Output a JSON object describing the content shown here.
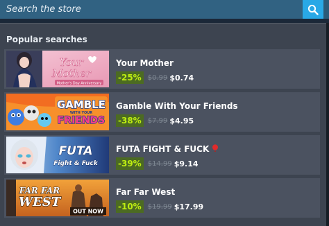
{
  "search": {
    "placeholder": "Search the store",
    "icon": "search-icon"
  },
  "popular": {
    "title": "Popular searches",
    "results": [
      {
        "title": "Your Mother",
        "discount": "-25%",
        "original_price": "$0.99",
        "final_price": "$0.74",
        "capsule": {
          "line1": "Your",
          "line2": "Mother",
          "subtitle": "Mother's Day Anniversary"
        }
      },
      {
        "title": "Gamble With Your Friends",
        "discount": "-38%",
        "original_price": "$7.99",
        "final_price": "$4.95",
        "capsule": {
          "line1": "GAMBLE",
          "small": "WITH YOUR",
          "line2": "FRIENDS"
        }
      },
      {
        "title": "FUTA FIGHT & FUCK",
        "title_icon": "red-heart-balloon-icon",
        "discount": "-39%",
        "original_price": "$14.99",
        "final_price": "$9.14",
        "capsule": {
          "line1": "FUTA",
          "line2": "Fight & Fuck"
        }
      },
      {
        "title": "Far Far West",
        "discount": "-10%",
        "original_price": "$19.99",
        "final_price": "$17.99",
        "capsule": {
          "line1": "FAR FAR",
          "line2": "WEST",
          "badge": "OUT NOW"
        }
      }
    ]
  },
  "colors": {
    "search_bg": "#316282",
    "search_button": "#29a8e6",
    "panel_bg": "#3d4450",
    "row_bg": "#4b5260",
    "discount_bg": "#4c6b22",
    "discount_text": "#beee11"
  }
}
